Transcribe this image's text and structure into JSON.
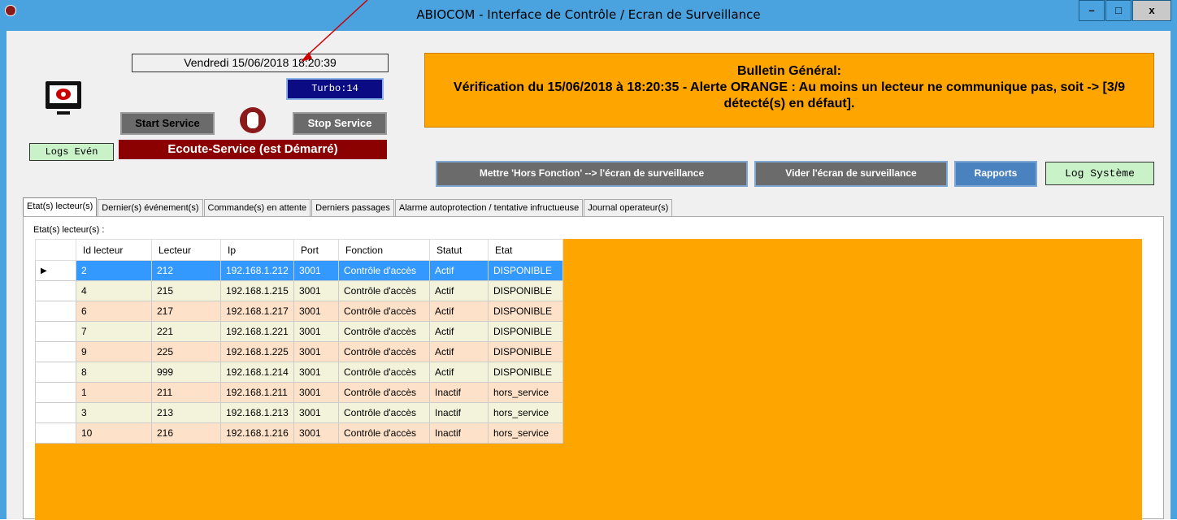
{
  "window": {
    "title": "ABIOCOM - Interface de Contrôle / Ecran de Surveillance",
    "minimize": "–",
    "maximize": "□",
    "close": "x"
  },
  "header": {
    "date": "Vendredi 15/06/2018 18:20:39",
    "turbo": "Turbo:14",
    "start_label": "Start Service",
    "stop_label": "Stop Service",
    "logs_label": "Logs Evén",
    "service_status": "Ecoute-Service (est Démarré)"
  },
  "bulletin": {
    "title": "Bulletin Général:",
    "message": "Vérification du 15/06/2018 à 18:20:35 - Alerte ORANGE : Au moins un lecteur ne communique pas, soit -> [3/9 détecté(s) en défaut]."
  },
  "actions": {
    "hors_fonction": "Mettre 'Hors Fonction' --> l'écran de surveillance",
    "vider": "Vider l'écran de surveillance",
    "rapports": "Rapports",
    "log_systeme": "Log Système"
  },
  "tabs": [
    {
      "label": "Etat(s) lecteur(s)"
    },
    {
      "label": "Dernier(s) événement(s)"
    },
    {
      "label": "Commande(s) en attente"
    },
    {
      "label": "Derniers passages"
    },
    {
      "label": "Alarme autoprotection  / tentative infructueuse"
    },
    {
      "label": "Journal operateur(s)"
    }
  ],
  "panel": {
    "label": "Etat(s) lecteur(s) :",
    "columns": [
      "Id lecteur",
      "Lecteur",
      "Ip",
      "Port",
      "Fonction",
      "Statut",
      "Etat"
    ],
    "rows": [
      [
        "2",
        "212",
        "192.168.1.212",
        "3001",
        "Contrôle d'accès",
        "Actif",
        "DISPONIBLE"
      ],
      [
        "4",
        "215",
        "192.168.1.215",
        "3001",
        "Contrôle d'accès",
        "Actif",
        "DISPONIBLE"
      ],
      [
        "6",
        "217",
        "192.168.1.217",
        "3001",
        "Contrôle d'accès",
        "Actif",
        "DISPONIBLE"
      ],
      [
        "7",
        "221",
        "192.168.1.221",
        "3001",
        "Contrôle d'accès",
        "Actif",
        "DISPONIBLE"
      ],
      [
        "9",
        "225",
        "192.168.1.225",
        "3001",
        "Contrôle d'accès",
        "Actif",
        "DISPONIBLE"
      ],
      [
        "8",
        "999",
        "192.168.1.214",
        "3001",
        "Contrôle d'accès",
        "Actif",
        "DISPONIBLE"
      ],
      [
        "1",
        "211",
        "192.168.1.211",
        "3001",
        "Contrôle d'accès",
        "Inactif",
        "hors_service"
      ],
      [
        "3",
        "213",
        "192.168.1.213",
        "3001",
        "Contrôle d'accès",
        "Inactif",
        "hors_service"
      ],
      [
        "10",
        "216",
        "192.168.1.216",
        "3001",
        "Contrôle d'accès",
        "Inactif",
        "hors_service"
      ]
    ],
    "selected_row_marker": "▶"
  },
  "colors": {
    "titlebar": "#4aa3df",
    "alert": "#ffa500",
    "service": "#8b0000",
    "selected": "#3399ff"
  }
}
